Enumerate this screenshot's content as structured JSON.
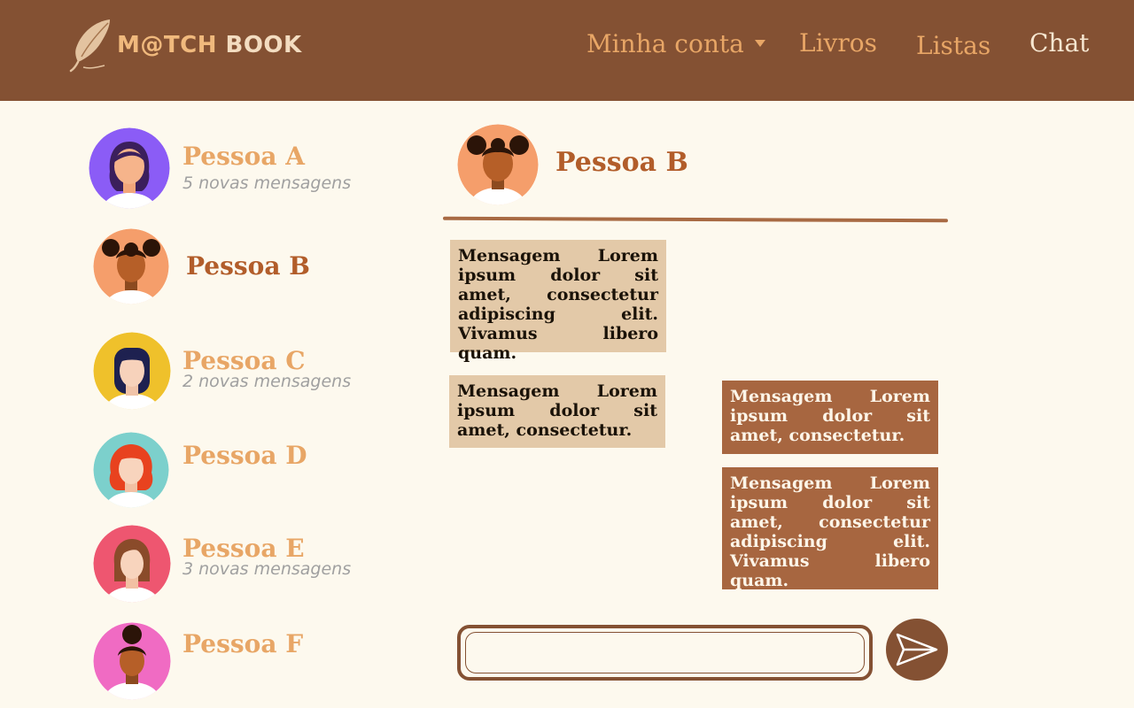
{
  "header": {
    "logo": {
      "part1": "M@TCH",
      "part2": "BOOK"
    },
    "nav": {
      "account": "Minha conta",
      "books": "Livros",
      "lists": "Listas",
      "chat": "Chat"
    }
  },
  "contacts": [
    {
      "name": "Pessoa A",
      "unread": "5 novas mensagens",
      "avatar_bg": "#8b5cf6"
    },
    {
      "name": "Pessoa B",
      "unread": "",
      "avatar_bg": "#f59e6b"
    },
    {
      "name": "Pessoa C",
      "unread": "2 novas mensagens",
      "avatar_bg": "#efc12b"
    },
    {
      "name": "Pessoa D",
      "unread": "",
      "avatar_bg": "#7cd0cc"
    },
    {
      "name": "Pessoa E",
      "unread": "3 novas mensagens",
      "avatar_bg": "#ee5670"
    },
    {
      "name": "Pessoa F",
      "unread": "",
      "avatar_bg": "#f06bc3"
    }
  ],
  "chat": {
    "title": "Pessoa B",
    "messages": [
      {
        "direction": "received",
        "text": "Mensagem Lorem ipsum dolor sit amet, consectetur adipiscing elit. Vivamus libero quam."
      },
      {
        "direction": "received",
        "text": "Mensagem Lorem ipsum dolor sit amet, consectetur."
      },
      {
        "direction": "sent",
        "text": "Mensagem Lorem ipsum dolor sit amet, consectetur."
      },
      {
        "direction": "sent",
        "text": "Mensagem Lorem ipsum dolor sit amet, consectetur adipiscing elit. Vivamus libero quam."
      }
    ],
    "input_value": ""
  },
  "colors": {
    "navbar": "#845133",
    "background": "#fdf9ee",
    "accent": "#e8a666",
    "selected": "#b25d2a",
    "bubble_received": "#e3c9a8",
    "bubble_sent": "#a76640"
  },
  "icons": {
    "logo": "feather-icon",
    "dropdown": "caret-down-icon",
    "send": "send-paper-plane-icon"
  }
}
